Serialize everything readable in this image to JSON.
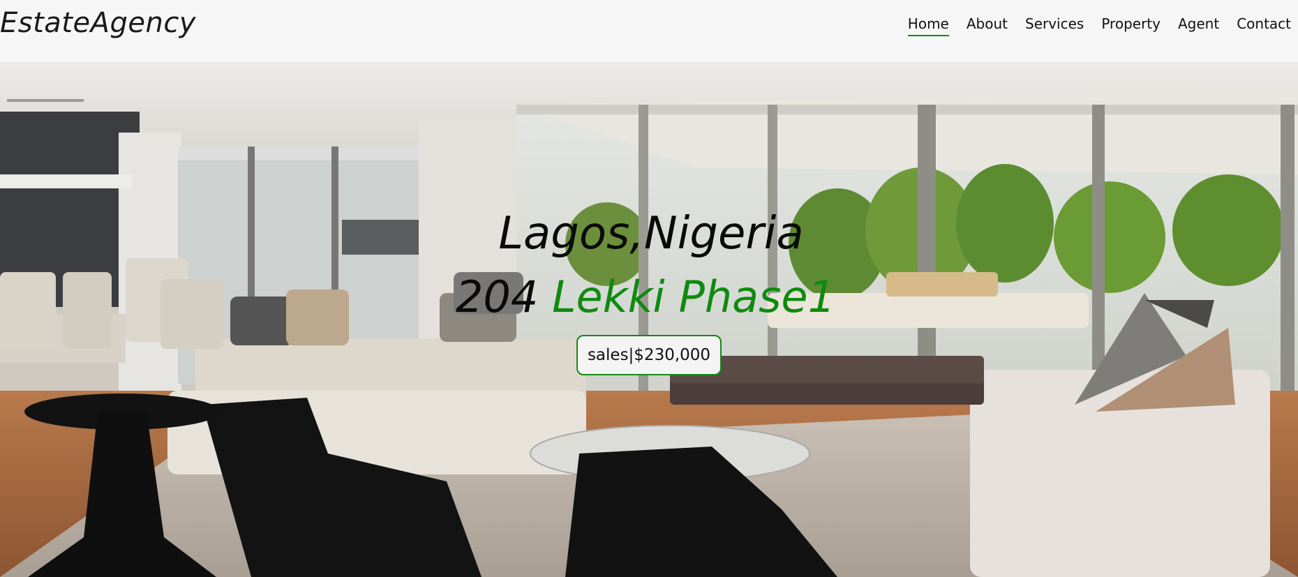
{
  "brand": {
    "name": "EstateAgency"
  },
  "nav": {
    "items": [
      {
        "label": "Home",
        "active": true
      },
      {
        "label": "About",
        "active": false
      },
      {
        "label": "Services",
        "active": false
      },
      {
        "label": "Property",
        "active": false
      },
      {
        "label": "Agent",
        "active": false
      },
      {
        "label": "Contact",
        "active": false
      }
    ]
  },
  "hero": {
    "city": "Lagos,Nigeria",
    "address_number": "204 ",
    "address_street": "Lekki Phase1",
    "price_text": "sales|$230,000"
  },
  "colors": {
    "accent": "#138a13",
    "text": "#0a0a0a",
    "navbar_bg": "#f6f6f6"
  }
}
